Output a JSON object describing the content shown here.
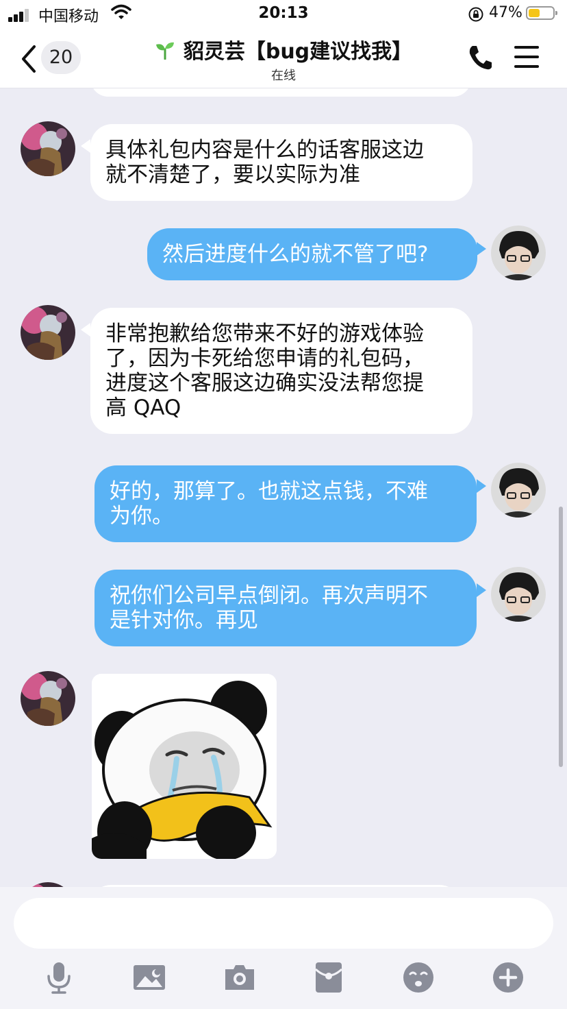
{
  "status_bar": {
    "carrier": "中国移动",
    "time": "20:13",
    "battery_percent": "47%",
    "battery_level": 0.47
  },
  "header": {
    "unread_count": "20",
    "title": "貂灵芸【bug建议找我】",
    "subtitle": "在线"
  },
  "messages": [
    {
      "from": "agent",
      "text": "具体礼包内容是什么的话客服这边\n就不清楚了，要以实际为准"
    },
    {
      "from": "me",
      "text": "然后进度什么的就不管了吧?"
    },
    {
      "from": "agent",
      "text": "非常抱歉给您带来不好的游戏体验\n了，因为卡死给您申请的礼包码，\n进度这个客服这边确实没法帮您提\n高 QAQ"
    },
    {
      "from": "me",
      "text": "好的，那算了。也就这点钱，不难\n为你。"
    },
    {
      "from": "me",
      "text": "祝你们公司早点倒闭。再次声明不\n是针对你。再见"
    },
    {
      "from": "agent",
      "type": "sticker",
      "sticker": "crying-panda-sticker"
    }
  ],
  "input": {
    "placeholder": ""
  },
  "toolbar": [
    "microphone-icon",
    "image-icon",
    "camera-icon",
    "red-packet-icon",
    "emoji-icon",
    "plus-icon"
  ],
  "colors": {
    "outgoing_bubble": "#5ab3f5",
    "incoming_bubble": "#ffffff",
    "chat_background": "#ececf4",
    "toolbar_icon": "#8a8d99"
  }
}
